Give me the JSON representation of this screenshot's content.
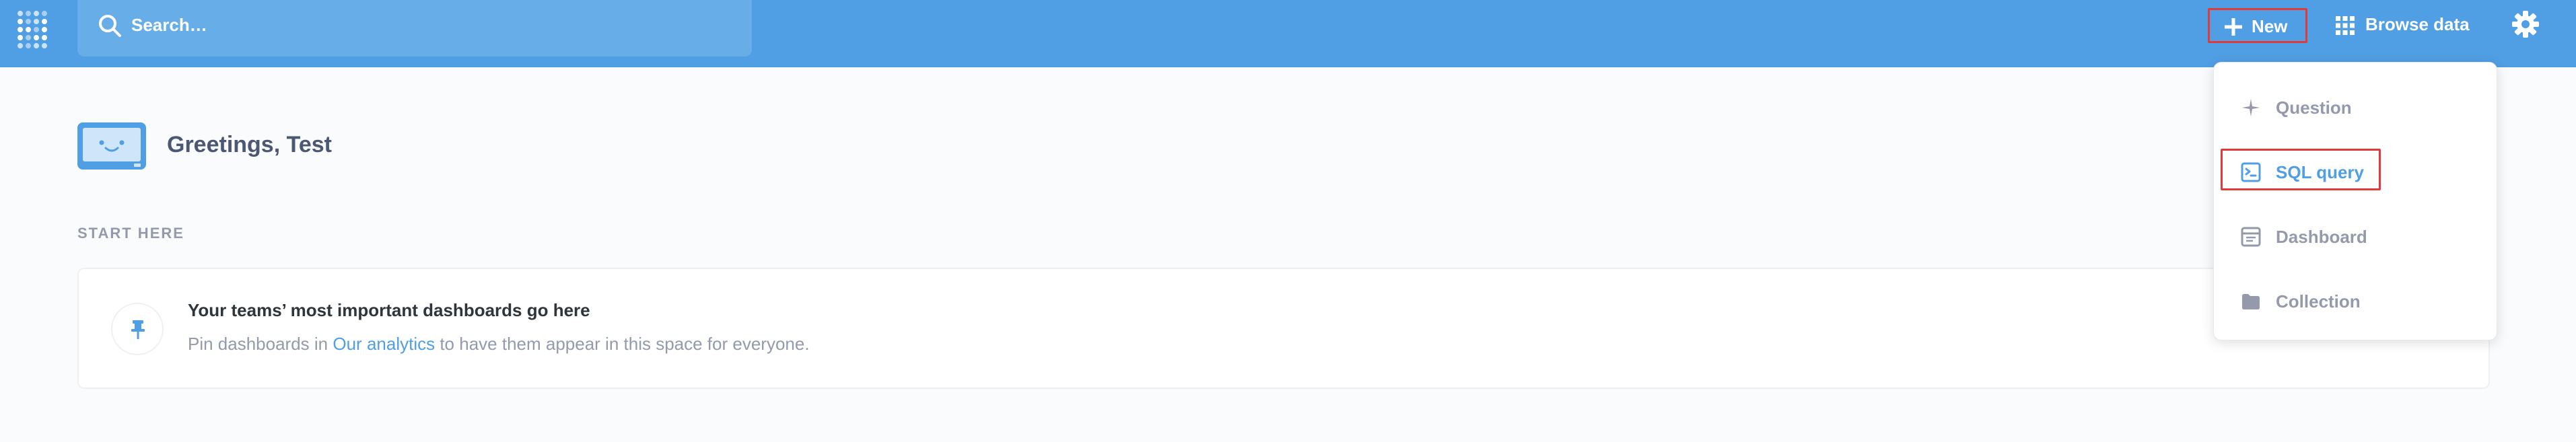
{
  "colors": {
    "brand": "#509ee3",
    "highlight": "#e03a3a",
    "text_dark": "#4c5773",
    "text_muted": "#949aab"
  },
  "topbar": {
    "search_placeholder": "Search…",
    "new_label": "New",
    "browse_label": "Browse data",
    "icons": [
      "metabase-logo-icon",
      "search-icon",
      "plus-icon",
      "grid-icon",
      "gear-icon"
    ]
  },
  "home": {
    "greeting": "Greetings, Test",
    "start_here": "START HERE",
    "pin_card": {
      "title": "Your teams’ most important dashboards go here",
      "desc_before": "Pin dashboards in ",
      "desc_link": "Our analytics",
      "desc_after": " to have them appear in this space for everyone."
    }
  },
  "new_menu": {
    "items": [
      {
        "label": "Question",
        "icon": "sparkle-icon"
      },
      {
        "label": "SQL query",
        "icon": "sql-icon"
      },
      {
        "label": "Dashboard",
        "icon": "dashboard-icon"
      },
      {
        "label": "Collection",
        "icon": "folder-icon"
      }
    ],
    "selected_index": 1
  }
}
